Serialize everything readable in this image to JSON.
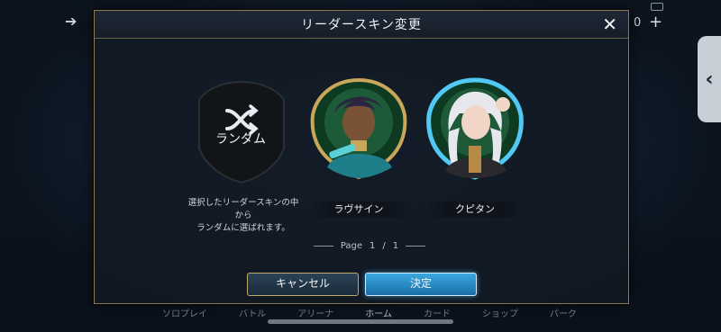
{
  "modal": {
    "title": "リーダースキン変更",
    "close_icon": "close-icon"
  },
  "skins": [
    {
      "name": "ランダム",
      "description_line1": "選択したリーダースキンの中から",
      "description_line2": "ランダムに選ばれます。",
      "icon": "shuffle-icon",
      "selected": false
    },
    {
      "name": "ラヴサイン",
      "selected": false
    },
    {
      "name": "クピタン",
      "selected": true
    }
  ],
  "pager": {
    "label": "Page",
    "current": "1",
    "separator": "/",
    "total": "1"
  },
  "buttons": {
    "cancel": "キャンセル",
    "confirm": "決定"
  },
  "background": {
    "counter": "0",
    "side_tab_icon": "chevron-left-icon",
    "nav": [
      "ソロプレイ",
      "バトル",
      "アリーナ",
      "ホーム",
      "カード",
      "ショップ",
      "パーク"
    ],
    "nav_active": "ホーム"
  },
  "colors": {
    "accent_blue": "#3aa7e0",
    "gold_border": "#c2a86b",
    "selected_glow": "#52c8f5"
  }
}
